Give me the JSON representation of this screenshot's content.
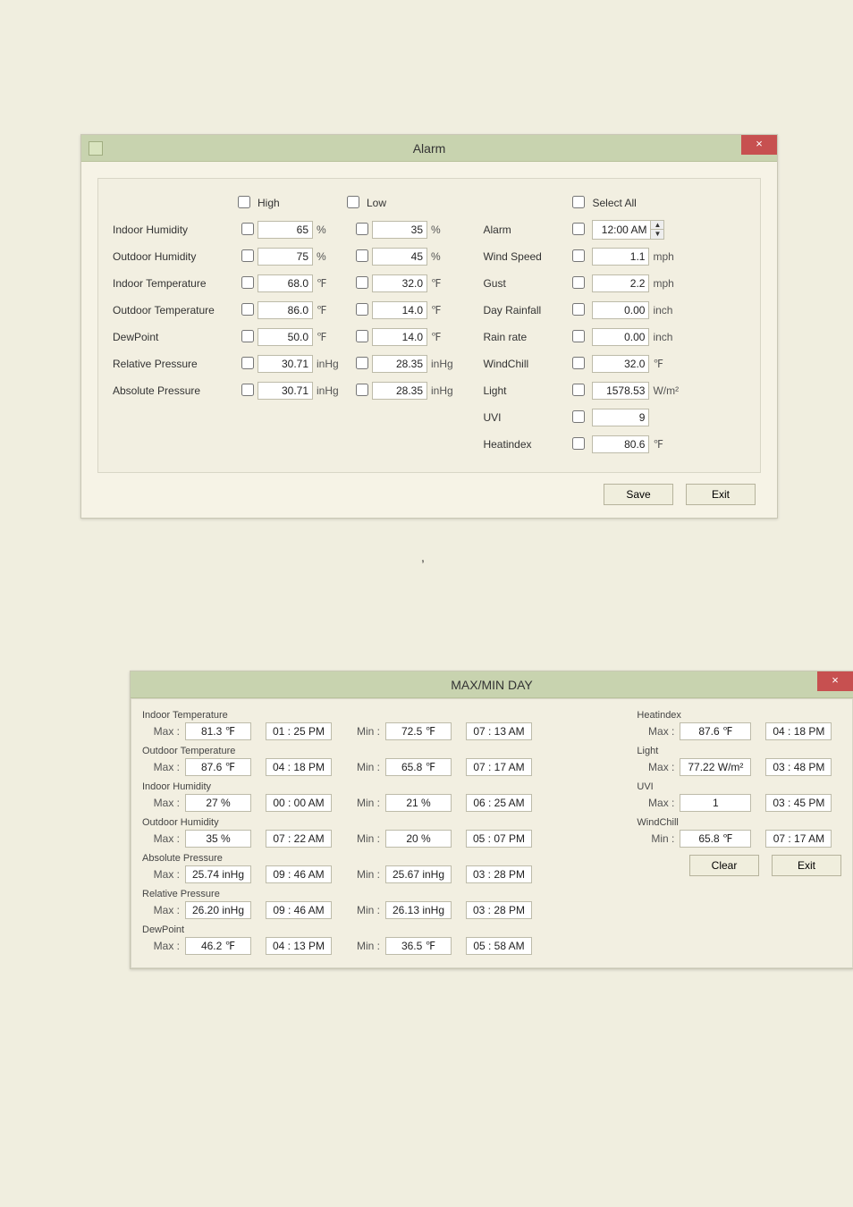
{
  "alarm": {
    "title": "Alarm",
    "select_all": "Select All",
    "col_high": "High",
    "col_low": "Low",
    "rows": [
      {
        "label": "Indoor Humidity",
        "high": "65",
        "low": "35",
        "unit": "%"
      },
      {
        "label": "Outdoor Humidity",
        "high": "75",
        "low": "45",
        "unit": "%"
      },
      {
        "label": "Indoor Temperature",
        "high": "68.0",
        "low": "32.0",
        "unit": "℉"
      },
      {
        "label": "Outdoor Temperature",
        "high": "86.0",
        "low": "14.0",
        "unit": "℉"
      },
      {
        "label": "DewPoint",
        "high": "50.0",
        "low": "14.0",
        "unit": "℉"
      },
      {
        "label": "Relative Pressure",
        "high": "30.71",
        "low": "28.35",
        "unit": "inHg"
      },
      {
        "label": "Absolute Pressure",
        "high": "30.71",
        "low": "28.35",
        "unit": "inHg"
      }
    ],
    "right": [
      {
        "label": "Alarm",
        "value": "12:00 AM",
        "unit": "",
        "spinner": true
      },
      {
        "label": "Wind Speed",
        "value": "1.1",
        "unit": "mph"
      },
      {
        "label": "Gust",
        "value": "2.2",
        "unit": "mph"
      },
      {
        "label": "Day Rainfall",
        "value": "0.00",
        "unit": "inch"
      },
      {
        "label": "Rain rate",
        "value": "0.00",
        "unit": "inch"
      },
      {
        "label": "WindChill",
        "value": "32.0",
        "unit": "℉"
      },
      {
        "label": "Light",
        "value": "1578.53",
        "unit": "W/m²"
      },
      {
        "label": "UVI",
        "value": "9",
        "unit": ""
      },
      {
        "label": "Heatindex",
        "value": "80.6",
        "unit": "℉"
      }
    ],
    "buttons": {
      "save": "Save",
      "exit": "Exit"
    }
  },
  "separator": ",",
  "mm": {
    "title": "MAX/MIN DAY",
    "maxlabel": "Max :",
    "minlabel": "Min :",
    "left": [
      {
        "section": "Indoor Temperature",
        "maxv": "81.3 ℉",
        "maxt": "01 : 25 PM",
        "minv": "72.5 ℉",
        "mint": "07 : 13 AM"
      },
      {
        "section": "Outdoor Temperature",
        "maxv": "87.6 ℉",
        "maxt": "04 : 18 PM",
        "minv": "65.8 ℉",
        "mint": "07 : 17 AM"
      },
      {
        "section": "Indoor Humidity",
        "maxv": "27 %",
        "maxt": "00 : 00 AM",
        "minv": "21 %",
        "mint": "06 : 25 AM"
      },
      {
        "section": "Outdoor Humidity",
        "maxv": "35 %",
        "maxt": "07 : 22 AM",
        "minv": "20 %",
        "mint": "05 : 07 PM"
      },
      {
        "section": "Absolute Pressure",
        "maxv": "25.74 inHg",
        "maxt": "09 : 46 AM",
        "minv": "25.67 inHg",
        "mint": "03 : 28 PM"
      },
      {
        "section": "Relative Pressure",
        "maxv": "26.20 inHg",
        "maxt": "09 : 46 AM",
        "minv": "26.13 inHg",
        "mint": "03 : 28 PM"
      },
      {
        "section": "DewPoint",
        "maxv": "46.2 ℉",
        "maxt": "04 : 13 PM",
        "minv": "36.5 ℉",
        "mint": "05 : 58 AM"
      }
    ],
    "right": [
      {
        "section": "Heatindex",
        "lab": "Max :",
        "v": "87.6 ℉",
        "t": "04 : 18 PM"
      },
      {
        "section": "Light",
        "lab": "Max :",
        "v": "77.22 W/m²",
        "t": "03 : 48 PM"
      },
      {
        "section": "UVI",
        "lab": "Max :",
        "v": "1",
        "t": "03 : 45 PM"
      },
      {
        "section": "WindChill",
        "lab": "Min :",
        "v": "65.8 ℉",
        "t": "07 : 17 AM"
      }
    ],
    "buttons": {
      "clear": "Clear",
      "exit": "Exit"
    }
  }
}
